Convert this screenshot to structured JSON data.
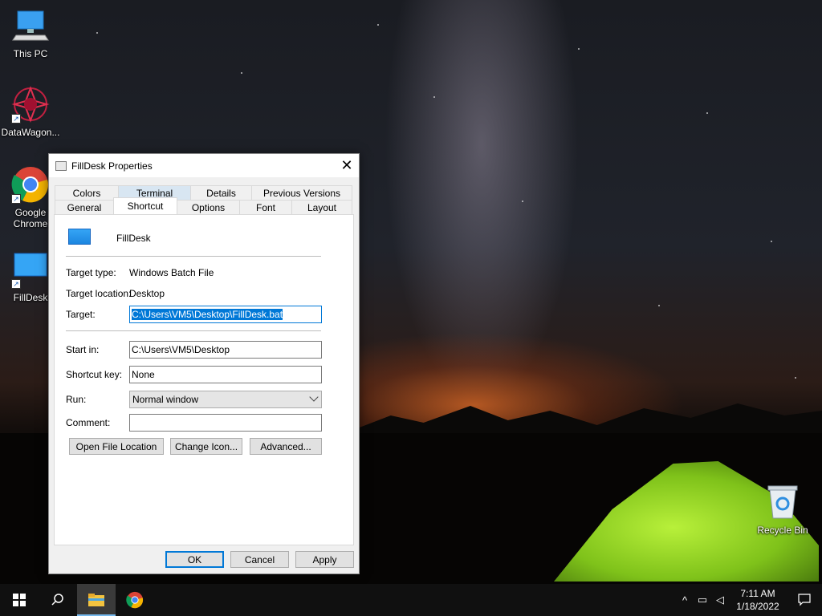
{
  "desktop": {
    "icons": [
      {
        "label": "This PC"
      },
      {
        "label": "DataWagon..."
      },
      {
        "label": "Google Chrome"
      },
      {
        "label": "FillDesk"
      },
      {
        "label": "Recycle Bin"
      }
    ]
  },
  "dialog": {
    "title": "FillDesk Properties",
    "tabs_top": [
      "Colors",
      "Terminal",
      "Details",
      "Previous Versions"
    ],
    "tabs_bottom": [
      "General",
      "Shortcut",
      "Options",
      "Font",
      "Layout"
    ],
    "active_tab": "Shortcut",
    "shortcut_name": "FillDesk",
    "target_type_label": "Target type:",
    "target_type_value": "Windows Batch File",
    "target_location_label": "Target location:",
    "target_location_value": "Desktop",
    "target_label": "Target:",
    "target_value": "C:\\Users\\VM5\\Desktop\\FillDesk.bat",
    "start_in_label": "Start in:",
    "start_in_value": "C:\\Users\\VM5\\Desktop",
    "shortcut_key_label": "Shortcut key:",
    "shortcut_key_value": "None",
    "run_label": "Run:",
    "run_value": "Normal window",
    "comment_label": "Comment:",
    "comment_value": "",
    "buttons": {
      "open_file_location": "Open File Location",
      "change_icon": "Change Icon...",
      "advanced": "Advanced...",
      "ok": "OK",
      "cancel": "Cancel",
      "apply": "Apply"
    }
  },
  "taskbar": {
    "time": "7:11 AM",
    "date": "1/18/2022"
  },
  "icons": {
    "start": "windows-logo-icon",
    "search": "search-icon",
    "explorer": "file-explorer-icon",
    "chrome": "chrome-icon",
    "tray_chevron": "chevron-up-icon",
    "network": "network-icon",
    "volume": "volume-muted-icon",
    "notifications": "notification-icon"
  },
  "colors": {
    "accent": "#0078d7",
    "taskbar": "#101010",
    "dialog_bg": "#f0f0f0"
  }
}
